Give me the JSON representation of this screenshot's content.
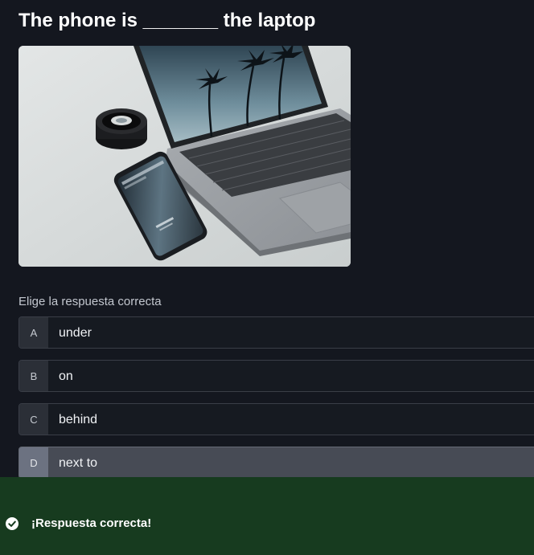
{
  "question": {
    "title": "The phone is _______ the laptop"
  },
  "image": {
    "phone_screen_title": "Explore Cards",
    "phone_screen_sub": "classic"
  },
  "answer_prompt": "Elige la respuesta correcta",
  "options": [
    {
      "letter": "A",
      "text": "under"
    },
    {
      "letter": "B",
      "text": "on"
    },
    {
      "letter": "C",
      "text": "behind"
    },
    {
      "letter": "D",
      "text": "next to"
    }
  ],
  "selected_option": "D",
  "feedback": {
    "message": "¡Respuesta correcta!",
    "icon": "check-circle-icon",
    "color": "#173b1f"
  },
  "colors": {
    "background": "#14171f",
    "option_background": "#161a21",
    "option_selected_background": "#474b55"
  }
}
